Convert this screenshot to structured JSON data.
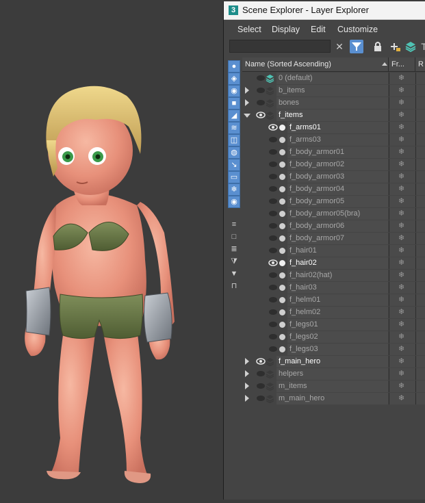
{
  "window": {
    "app_icon": "3",
    "title": "Scene Explorer - Layer Explorer"
  },
  "menu": [
    "Select",
    "Display",
    "Edit",
    "Customize"
  ],
  "toolbar": {
    "search_value": "",
    "icons": [
      "clear-search-icon",
      "filter-icon",
      "lock-icon",
      "add-layer-icon",
      "layers-icon"
    ]
  },
  "sidebar_icons": [
    "circle-icon",
    "shapes-icon",
    "light-icon",
    "camera-icon",
    "helper-icon",
    "spacewarp-icon",
    "group-icon",
    "xref-icon",
    "bone-icon",
    "container-icon",
    "frozen-icon",
    "hidden-icon",
    "list-icon",
    "blank-icon",
    "list2-icon",
    "filter-off-icon",
    "filter-icon",
    "selection-set-icon"
  ],
  "columns": {
    "name": "Name (Sorted Ascending)",
    "frozen": "Fr...",
    "render": "R"
  },
  "rows": [
    {
      "label": "0 (default)",
      "type": "layer",
      "level": 0,
      "expand": "",
      "visible": false,
      "dim": true
    },
    {
      "label": "b_items",
      "type": "layer",
      "level": 0,
      "expand": "right",
      "visible": false,
      "dim": true
    },
    {
      "label": "bones",
      "type": "layer",
      "level": 0,
      "expand": "right",
      "visible": false,
      "dim": true
    },
    {
      "label": "f_items",
      "type": "layer",
      "level": 0,
      "expand": "down",
      "visible": true,
      "dim": false
    },
    {
      "label": "f_arms01",
      "type": "object",
      "level": 1,
      "visible": true,
      "dim": false
    },
    {
      "label": "f_arms03",
      "type": "object",
      "level": 1,
      "visible": false,
      "dim": true
    },
    {
      "label": "f_body_armor01",
      "type": "object",
      "level": 1,
      "visible": false,
      "dim": true
    },
    {
      "label": "f_body_armor02",
      "type": "object",
      "level": 1,
      "visible": false,
      "dim": true
    },
    {
      "label": "f_body_armor03",
      "type": "object",
      "level": 1,
      "visible": false,
      "dim": true
    },
    {
      "label": "f_body_armor04",
      "type": "object",
      "level": 1,
      "visible": false,
      "dim": true
    },
    {
      "label": "f_body_armor05",
      "type": "object",
      "level": 1,
      "visible": false,
      "dim": true
    },
    {
      "label": "f_body_armor05(bra)",
      "type": "object",
      "level": 1,
      "visible": false,
      "dim": true
    },
    {
      "label": "f_body_armor06",
      "type": "object",
      "level": 1,
      "visible": false,
      "dim": true
    },
    {
      "label": "f_body_armor07",
      "type": "object",
      "level": 1,
      "visible": false,
      "dim": true
    },
    {
      "label": "f_hair01",
      "type": "object",
      "level": 1,
      "visible": false,
      "dim": true
    },
    {
      "label": "f_hair02",
      "type": "object",
      "level": 1,
      "visible": true,
      "dim": false
    },
    {
      "label": "f_hair02(hat)",
      "type": "object",
      "level": 1,
      "visible": false,
      "dim": true
    },
    {
      "label": "f_hair03",
      "type": "object",
      "level": 1,
      "visible": false,
      "dim": true
    },
    {
      "label": "f_helm01",
      "type": "object",
      "level": 1,
      "visible": false,
      "dim": true
    },
    {
      "label": "f_helm02",
      "type": "object",
      "level": 1,
      "visible": false,
      "dim": true
    },
    {
      "label": "f_legs01",
      "type": "object",
      "level": 1,
      "visible": false,
      "dim": true
    },
    {
      "label": "f_legs02",
      "type": "object",
      "level": 1,
      "visible": false,
      "dim": true
    },
    {
      "label": "f_legs03",
      "type": "object",
      "level": 1,
      "visible": false,
      "dim": true
    },
    {
      "label": "f_main_hero",
      "type": "layer",
      "level": 0,
      "expand": "right",
      "visible": true,
      "dim": false
    },
    {
      "label": "helpers",
      "type": "layer",
      "level": 0,
      "expand": "right",
      "visible": false,
      "dim": true
    },
    {
      "label": "m_items",
      "type": "layer",
      "level": 0,
      "expand": "right",
      "visible": false,
      "dim": true
    },
    {
      "label": "m_main_hero",
      "type": "layer",
      "level": 0,
      "expand": "right",
      "visible": false,
      "dim": true
    }
  ],
  "frozen_glyph": "❄",
  "colors": {
    "accent": "#5a8fd0",
    "text_bright": "#ffffff",
    "text_dim": "#a8a8a8",
    "panel": "#444444"
  }
}
